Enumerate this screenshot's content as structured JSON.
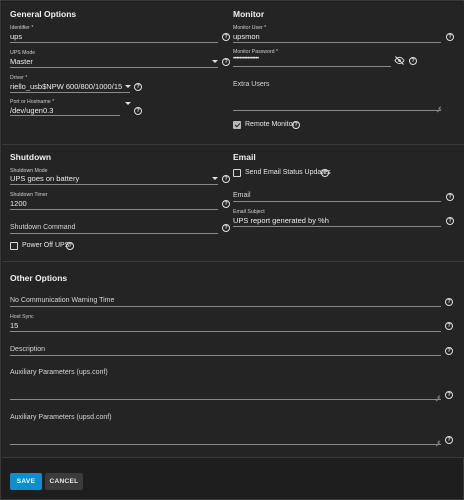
{
  "general": {
    "title": "General Options",
    "identifier_label": "Identifier *",
    "identifier_value": "ups",
    "ups_mode_label": "UPS Mode",
    "ups_mode_value": "Master",
    "driver_label": "Driver *",
    "driver_value": "riello_usb$NPW 600/800/1000/1500/20",
    "port_label": "Port or Hostname *",
    "port_value": "/dev/ugen0.3"
  },
  "monitor": {
    "title": "Monitor",
    "user_label": "Monitor User *",
    "user_value": "upsmon",
    "password_label": "Monitor Password *",
    "password_value": "••••••••••••••••",
    "extra_users_placeholder": "Extra Users",
    "remote_monitor_label": "Remote Monitor",
    "remote_monitor_checked": true
  },
  "shutdown": {
    "title": "Shutdown",
    "mode_label": "Shutdown Mode",
    "mode_value": "UPS goes on battery",
    "timer_label": "Shutdown Timer",
    "timer_value": "1200",
    "command_placeholder": "Shutdown Command",
    "power_off_label": "Power Off UPS",
    "power_off_checked": false
  },
  "email": {
    "title": "Email",
    "send_updates_label": "Send Email Status Updates",
    "send_updates_checked": false,
    "email_placeholder": "Email",
    "subject_label": "Email Subject",
    "subject_value": "UPS report generated by %h"
  },
  "other": {
    "title": "Other Options",
    "no_comm_placeholder": "No Communication Warning Time",
    "host_sync_label": "Host Sync",
    "host_sync_value": "15",
    "description_placeholder": "Description",
    "aux_ups_placeholder": "Auxiliary Parameters (ups.conf)",
    "aux_upsd_placeholder": "Auxiliary Parameters (upsd.conf)"
  },
  "actions": {
    "save_label": "SAVE",
    "cancel_label": "CANCEL"
  },
  "icons": {
    "help": "help-circle-icon",
    "dropdown": "chevron-down-icon",
    "visibility": "eye-off-icon",
    "checkbox": "checkbox-icon"
  },
  "colors": {
    "save_button": "#0f8ecf",
    "background": "#242424"
  }
}
